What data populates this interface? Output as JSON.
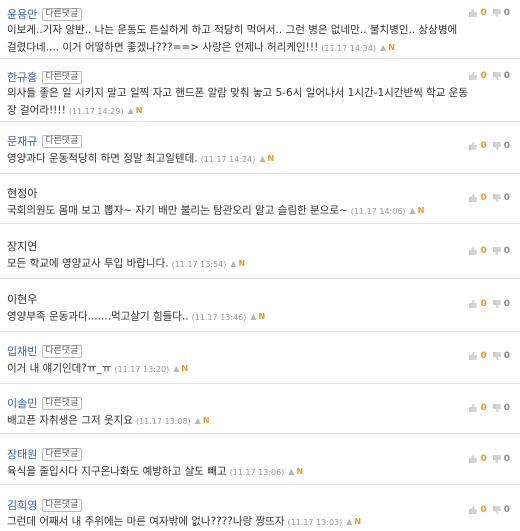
{
  "reply_label": "다른댓글",
  "comments": [
    {
      "name": "윤용만",
      "name_color": "blue",
      "lines": [
        "이보게..기자 양반.. 나는 운동도 튼실하게 하고 적당히 먹어서.. 그런 병은 없네만.. 불치병인.. 상상병에",
        "걸렸다네.... 이거 어떻하면 좋겠나???==> 사랑은 언제나 허리케인!!!"
      ],
      "timestamp": "(11.17 14:34)",
      "up": "0",
      "down": "0"
    },
    {
      "name": "한규홍",
      "name_color": "blue",
      "lines": [
        "의사들 좋은 일 시키지 말고 일찍 자고 핸드폰 알람 맞춰 놓고 5-6시 일어나서 1시간-1시간반씩 학교 운동",
        "장 걸어라!!!!"
      ],
      "timestamp": "(11.17 14:29)",
      "up": "0",
      "down": "0"
    },
    {
      "name": "문재규",
      "name_color": "blue",
      "lines": [
        "영양과다 운동적당히 하면 정말 최고일텐데."
      ],
      "timestamp": "(11.17 14:24)",
      "up": "0",
      "down": "0"
    },
    {
      "name": "현정아",
      "name_color": "gray",
      "lines": [
        "국회의원도 몸매 보고 뽑자~ 자기 배만 불리는 탐관오리 말고 슬림한 분으로~"
      ],
      "timestamp": "(11.17 14:06)",
      "up": "0",
      "down": "0"
    },
    {
      "name": "장지연",
      "name_color": "gray",
      "lines": [
        "모든 학교에 영양교사 투입 바랍니다."
      ],
      "timestamp": "(11.17 13:54)",
      "up": "0",
      "down": "0"
    },
    {
      "name": "이현우",
      "name_color": "gray",
      "lines": [
        "영양부족 운동과다.......먹고살기 힘들다.."
      ],
      "timestamp": "(11.17 13:46)",
      "up": "0",
      "down": "0"
    },
    {
      "name": "입채빈",
      "name_color": "blue",
      "lines": [
        "이거 내 얘기인데?ㅠ_ㅠ"
      ],
      "timestamp": "(11.17 13:20)",
      "up": "0",
      "down": "0"
    },
    {
      "name": "이솔민",
      "name_color": "blue",
      "lines": [
        "배고픈 자취생은 그저 웃지요"
      ],
      "timestamp": "(11.17 13:08)",
      "up": "0",
      "down": "0"
    },
    {
      "name": "장태원",
      "name_color": "blue",
      "lines": [
        "육식을 줄입시다 지구온나화도 예방하고 살도 빼고"
      ],
      "timestamp": "(11.17 13:06)",
      "up": "0",
      "down": "0"
    },
    {
      "name": "김희영",
      "name_color": "blue",
      "lines": [
        "그런데 어째서 내 주위에는 마른 여자밖에 없나????나랑 짱뜨자"
      ],
      "timestamp": "(11.17 13:03)",
      "up": "0",
      "down": "0"
    }
  ]
}
